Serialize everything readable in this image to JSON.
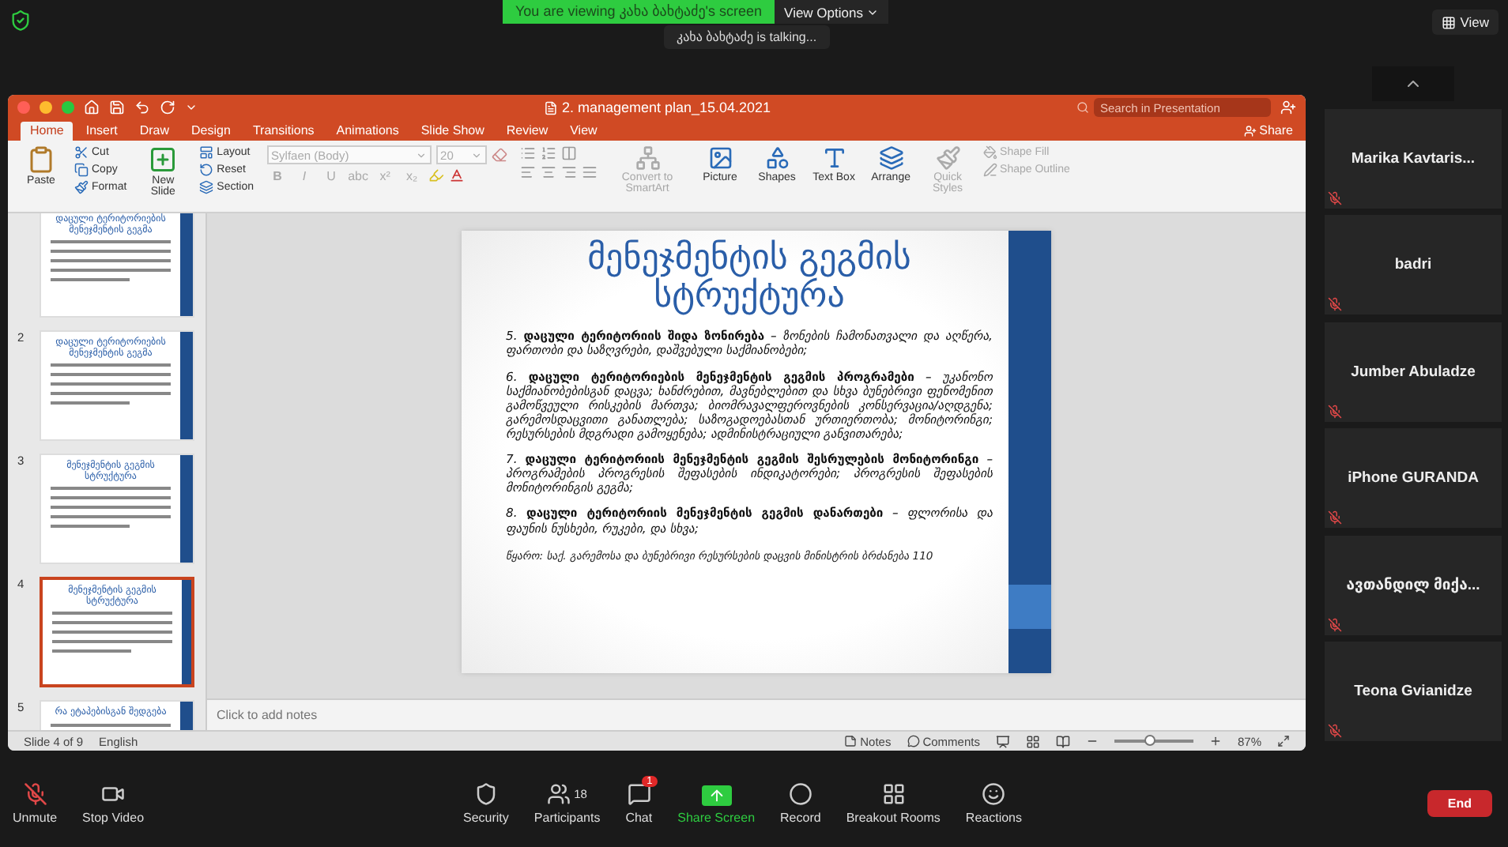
{
  "zoom_top": {
    "sharing_banner": "You are viewing კახა ბახტაძე's screen",
    "view_options": "View Options",
    "talking": "კახა ბახტაძე is  talking...",
    "view": "View"
  },
  "window": {
    "title": "2. management plan_15.04.2021",
    "search": {
      "placeholder": "Search in Presentation"
    }
  },
  "tabs": [
    {
      "label": "Home",
      "selected": true
    },
    {
      "label": "Insert",
      "selected": false
    },
    {
      "label": "Draw",
      "selected": false
    },
    {
      "label": "Design",
      "selected": false
    },
    {
      "label": "Transitions",
      "selected": false
    },
    {
      "label": "Animations",
      "selected": false
    },
    {
      "label": "Slide Show",
      "selected": false
    },
    {
      "label": "Review",
      "selected": false
    },
    {
      "label": "View",
      "selected": false
    }
  ],
  "share": "Share",
  "ribbon": {
    "paste": "Paste",
    "clipboard_items": [
      {
        "label": "Cut",
        "kind": "cut"
      },
      {
        "label": "Copy",
        "kind": "copy"
      },
      {
        "label": "Format",
        "kind": "format"
      }
    ],
    "new_slide": "New Slide",
    "slide_items": [
      {
        "label": "Layout",
        "kind": "layout"
      },
      {
        "label": "Reset",
        "kind": "reset"
      },
      {
        "label": "Section",
        "kind": "section"
      }
    ],
    "font": {
      "name": "Sylfaen (Body)",
      "size": "20",
      "disabled": true
    },
    "format_buttons": [
      "B",
      "I",
      "U",
      "abc",
      "x²",
      "x₂"
    ],
    "tools": [
      {
        "label": "Convert to SmartArt",
        "kind": "smartart",
        "disabled": true
      },
      {
        "label": "Picture",
        "kind": "picture",
        "disabled": false
      },
      {
        "label": "Shapes",
        "kind": "shapes",
        "disabled": false
      },
      {
        "label": "Text Box",
        "kind": "textbox",
        "disabled": false
      },
      {
        "label": "Arrange",
        "kind": "arrange",
        "disabled": false
      },
      {
        "label": "Quick Styles",
        "kind": "quickstyles",
        "disabled": true
      }
    ],
    "shape_styles": [
      {
        "label": "Shape Fill",
        "kind": "fill",
        "disabled": true
      },
      {
        "label": "Shape Outline",
        "kind": "outline",
        "disabled": true
      }
    ]
  },
  "thumbnails": [
    {
      "title": "დაცული ტერიტორიების მენეჯმენტის გეგმა",
      "selected": false
    },
    {
      "number": "2",
      "title": "დაცული ტერიტორიების მენეჯმენტის გეგმა",
      "selected": false
    },
    {
      "number": "3",
      "title": "მენეჯმენტის გეგმის სტრუქტურა",
      "selected": false
    },
    {
      "number": "4",
      "title": "მენეჯმენტის გეგმის სტრუქტურა",
      "selected": true
    },
    {
      "number": "5",
      "title": "რა ეტაპებისგან შედგება",
      "selected": false
    }
  ],
  "slide": {
    "title": "მენეჯმენტის გეგმის სტრუქტურა",
    "items": [
      "5. **დაცული ტერიტორიის შიდა ზონირება** – ზონების ჩამონათვალი და აღწერა, ფართობი და საზღვრები, დაშვებული საქმიანობები;",
      "6. **დაცული ტერიტორიების მენეჯმენტის გეგმის პროგრამები** – უკანონო საქმიანობებისგან დაცვა; ხანძრებით, მავნებლებით და სხვა ბუნებრივი ფენომენით გამოწვეული რისკების მართვა; ბიომრავალფეროვნების კონსერვაცია/აღდგენა; გარემოსდაცვითი განათლება; საზოგადოებასთან ურთიერთობა; მონიტორინგი; რესურსების მდგრადი გამოყენება; ადმინისტრაციული განვითარება;",
      "7. **დაცული ტერიტორიის მენეჯმენტის გეგმის შესრულების მონიტორინგი** – პროგრამების პროგრესის შეფასების ინდიკატორები; პროგრესის შეფასების მონიტორინგის გეგმა;",
      "8. **დაცული ტერიტორიის მენეჯმენტის გეგმის დანართები** – ფლორისა და ფაუნის ნუსხები, რუკები, და სხვა;"
    ],
    "source": "წყარო: საქ. გარემოსა და ბუნებრივი რესურსების დაცვის მინისტრის ბრძანება 110"
  },
  "notes": {
    "placeholder": "Click to add notes"
  },
  "status_bar": {
    "slide": "Slide 4 of 9",
    "language": "English",
    "notes": "Notes",
    "comments": "Comments",
    "zoom": {
      "level": 0.45,
      "reading": "87%"
    }
  },
  "participants": [
    {
      "name": "Marika  Kavtaris...",
      "muted": true
    },
    {
      "name": "badri",
      "muted": true
    },
    {
      "name": "Jumber Abuladze",
      "muted": true
    },
    {
      "name": "iPhone GURANDA",
      "muted": true
    },
    {
      "name": "ავთანდილ მიქა...",
      "muted": true
    },
    {
      "name": "Teona Gvianidze",
      "muted": true
    }
  ],
  "toolbar": [
    {
      "label": "Unmute",
      "kind": "mic"
    },
    {
      "label": "Stop Video",
      "kind": "video"
    },
    {
      "label": "Security",
      "kind": "security"
    },
    {
      "label": "Participants",
      "kind": "participants",
      "count": "18"
    },
    {
      "label": "Chat",
      "kind": "chat",
      "badge": "1"
    },
    {
      "label": "Share Screen",
      "kind": "share"
    },
    {
      "label": "Record",
      "kind": "record"
    },
    {
      "label": "Breakout Rooms",
      "kind": "breakout"
    },
    {
      "label": "Reactions",
      "kind": "reactions"
    }
  ],
  "end": "End"
}
